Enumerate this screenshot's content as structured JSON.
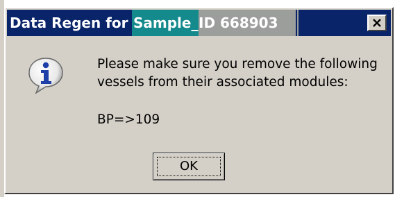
{
  "window": {
    "title_part1": "Data Regen for",
    "title_part2": "Sample_",
    "title_part3": "ID 668903",
    "close_glyph": "✕"
  },
  "dialog": {
    "icon": "info-icon",
    "message_line1": "Please make sure you remove the following",
    "message_line2": "vessels from their associated modules:",
    "value": "BP=>109"
  },
  "buttons": {
    "ok_label": "OK"
  },
  "colors": {
    "titlebar": "#0a246a",
    "dialog_bg": "#d4d0c8",
    "icon_blue": "#1e3fa8"
  }
}
